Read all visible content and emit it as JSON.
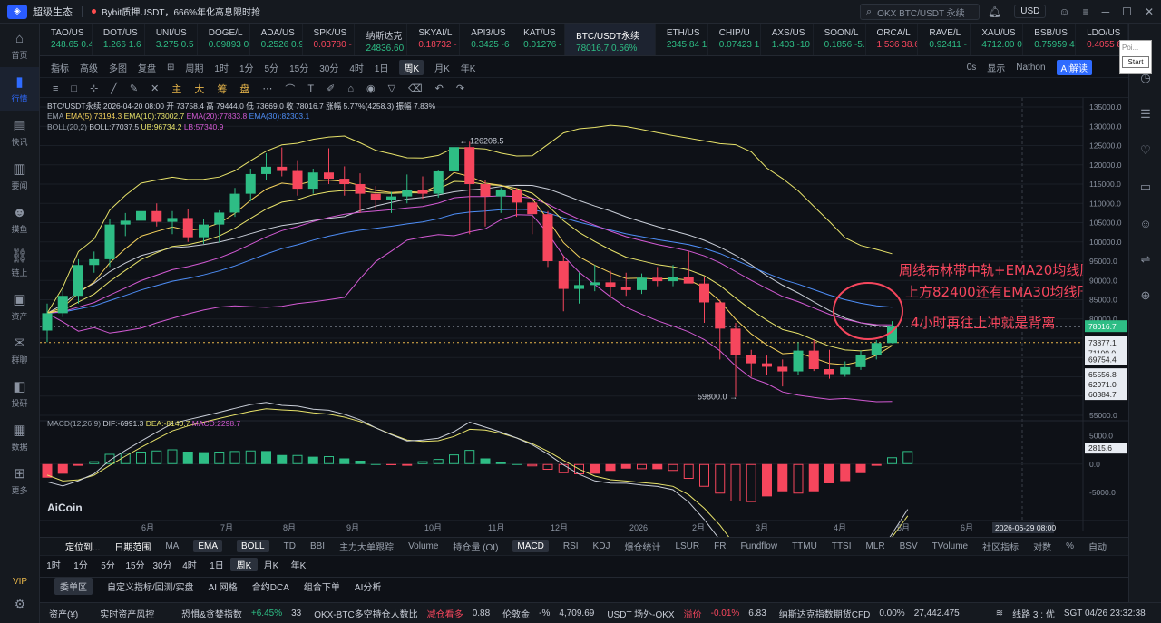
{
  "titlebar": {
    "app_name": "超级生态",
    "promo": "Bybit质押USDT，666%年化高息限时抢",
    "search_text": "OKX BTC/USDT 永续",
    "currency": "USD"
  },
  "sidebar": [
    {
      "label": "首页",
      "icon": "home-icon"
    },
    {
      "label": "行情",
      "icon": "chart-icon",
      "active": true
    },
    {
      "label": "快讯",
      "icon": "news-icon"
    },
    {
      "label": "要闻",
      "icon": "book-icon"
    },
    {
      "label": "摸鱼",
      "icon": "robot-icon"
    },
    {
      "label": "链上",
      "icon": "chain-icon"
    },
    {
      "label": "资产",
      "icon": "wallet-icon"
    },
    {
      "label": "群聊",
      "icon": "chat-icon"
    },
    {
      "label": "投研",
      "icon": "research-icon"
    },
    {
      "label": "数据",
      "icon": "data-icon"
    },
    {
      "label": "更多",
      "icon": "more-icon"
    }
  ],
  "sidebar_vip": "VIP",
  "tickers": [
    {
      "name": "TAO/US",
      "price": "248.65 0.4",
      "dir": "up"
    },
    {
      "name": "DOT/US",
      "price": "1.266 1.6",
      "dir": "up"
    },
    {
      "name": "UNI/US",
      "price": "3.275 0.5",
      "dir": "up"
    },
    {
      "name": "DOGE/L",
      "price": "0.09893 0",
      "dir": "up"
    },
    {
      "name": "ADA/US",
      "price": "0.2526 0.9",
      "dir": "up"
    },
    {
      "name": "SPK/US",
      "price": "0.03780 -",
      "dir": "dn"
    },
    {
      "name": "纳斯达克",
      "price": "24836.60 (",
      "dir": "up"
    },
    {
      "name": "SKYAI/L",
      "price": "0.18732 -",
      "dir": "dn"
    },
    {
      "name": "API3/US",
      "price": "0.3425 -6",
      "dir": "up"
    },
    {
      "name": "KAT/US",
      "price": "0.01276 -",
      "dir": "up"
    },
    {
      "name": "BTC/USDT永续",
      "price": "78016.7 0.56%",
      "dir": "up",
      "selected": true
    },
    {
      "name": "ETH/US",
      "price": "2345.84 1",
      "dir": "up"
    },
    {
      "name": "CHIP/U",
      "price": "0.07423 1",
      "dir": "up"
    },
    {
      "name": "AXS/US",
      "price": "1.403 -10",
      "dir": "up"
    },
    {
      "name": "SOON/L",
      "price": "0.1856 -5.",
      "dir": "up"
    },
    {
      "name": "ORCA/L",
      "price": "1.536 38.6",
      "dir": "dn"
    },
    {
      "name": "RAVE/L",
      "price": "0.92411 -",
      "dir": "up"
    },
    {
      "name": "XAU/US",
      "price": "4712.00 0",
      "dir": "up"
    },
    {
      "name": "BSB/US",
      "price": "0.75959 4",
      "dir": "up"
    },
    {
      "name": "LDO/US",
      "price": "0.4055 8.5",
      "dir": "dn"
    }
  ],
  "popup": {
    "poi": "Poi...",
    "start": "Start"
  },
  "toolbar1": {
    "items": [
      "指标",
      "高级",
      "多图",
      "复盘",
      "⊞",
      "周期",
      "1时",
      "1分",
      "5分",
      "15分",
      "30分",
      "4时",
      "1日",
      "周K",
      "月K",
      "年K"
    ],
    "active": "周K",
    "right": [
      "0s",
      "显示",
      "Nathon",
      "AI解读"
    ]
  },
  "toolbar2_cn": [
    "主",
    "大",
    "筹",
    "盘"
  ],
  "legend": {
    "line1": "BTC/USDT永续  2026-04-20 08:00  开 73758.4  高 79444.0  低 73669.0  收 78016.7  涨幅 5.77%(4258.3)  振幅 7.83%",
    "ema_label": "EMA",
    "ema5": "EMA(5):73194.3",
    "ema10": "EMA(10):73002.7",
    "ema20": "EMA(20):77833.8",
    "ema30": "EMA(30):82303.1",
    "boll_label": "BOLL(20,2)",
    "boll_mid": "BOLL:77037.5",
    "boll_ub": "UB:96734.2",
    "boll_lb": "LB:57340.9",
    "macd_label": "MACD(12,26,9)",
    "dif": "DIF:-6991.3",
    "dea": "DEA:-8140.7",
    "macd": "MACD:2298.7"
  },
  "annotation": {
    "line1": "周线布林带中轨+EMA20均线压制",
    "line2": "上方82400还有EMA30均线压制",
    "line3": "4小时再往上冲就是背离"
  },
  "chart_labels": {
    "high_label": "← 126208.5",
    "low_label": "59800.0 →",
    "watermark": "AiCoin",
    "date_tag": "2026-06-29 08:00"
  },
  "price_axis": {
    "ticks": [
      "135000.0",
      "130000.0",
      "125000.0",
      "120000.0",
      "115000.0",
      "110000.0",
      "105000.0",
      "100000.0",
      "95000.0",
      "90000.0",
      "85000.0",
      "80000.0",
      "75000.0",
      "70000.0",
      "65000.0",
      "60000.0",
      "55000.0"
    ],
    "current": "78016.7",
    "markers": [
      "73877.1",
      "71100.0",
      "69754.4",
      "65556.8",
      "62971.0",
      "60384.7"
    ],
    "macd_ticks": [
      "5000.0",
      "0.0",
      "-5000.0"
    ],
    "macd_current": "2815.6"
  },
  "time_axis": [
    "6月",
    "7月",
    "8月",
    "9月",
    "10月",
    "11月",
    "12月",
    "2026",
    "2月",
    "3月",
    "4月",
    "5月",
    "6月"
  ],
  "indicator_bar": {
    "items": [
      "定位到...",
      "日期范围",
      "MA",
      "EMA",
      "BOLL",
      "TD",
      "BBI",
      "主力大单跟踪",
      "Volume",
      "持仓量 (OI)",
      "MACD",
      "RSI",
      "KDJ",
      "爆仓统计",
      "LSUR",
      "FR",
      "Fundflow",
      "TTMU",
      "TTSI",
      "MLR",
      "BSV",
      "TVolume",
      "社区指标",
      "对数",
      "%",
      "自动"
    ],
    "active": [
      "EMA",
      "BOLL",
      "MACD"
    ]
  },
  "timeframes": {
    "items": [
      "1时",
      "1分",
      "5分",
      "15分",
      "30分",
      "4时",
      "1日",
      "周K",
      "月K",
      "年K"
    ],
    "active": "周K"
  },
  "bottom_tabs": {
    "items": [
      "委单区",
      "自定义指标/回测/实盘",
      "AI 网格",
      "合约DCA",
      "组合下单",
      "AI分析"
    ],
    "active": "委单区"
  },
  "statusbar": {
    "asset": "资产(¥)",
    "risk": "实时资产风控",
    "fear_label": "恐惧&贪婪指数",
    "fear_change": "+6.45%",
    "fear_value": "33",
    "ratio_label": "OKX-BTC多空持仓人数比",
    "ratio_tag": "减仓看多",
    "ratio_value": "0.88",
    "lun_label": "伦敦金",
    "lun_change": "-%",
    "lun_value": "4,709.69",
    "usdt_label": "USDT 场外-OKX",
    "usdt_tag": "溢价",
    "usdt_change": "-0.01%",
    "usdt_value": "6.83",
    "nas_label": "纳斯达克指数期货CFD",
    "nas_change": "0.00%",
    "nas_value": "27,442.475",
    "line": "线路 3 : 优",
    "time": "SGT 04/26 23:32:38"
  },
  "chart_data": {
    "type": "candlestick",
    "interval": "1W",
    "ylim": [
      55000,
      135000
    ],
    "candles": [
      {
        "o": 77000,
        "h": 84000,
        "l": 74000,
        "c": 81500
      },
      {
        "o": 81500,
        "h": 87500,
        "l": 80500,
        "c": 86000
      },
      {
        "o": 86000,
        "h": 95500,
        "l": 84000,
        "c": 94000
      },
      {
        "o": 94000,
        "h": 97500,
        "l": 92000,
        "c": 95500
      },
      {
        "o": 95500,
        "h": 106000,
        "l": 93500,
        "c": 104500
      },
      {
        "o": 104500,
        "h": 107500,
        "l": 101500,
        "c": 105500
      },
      {
        "o": 105500,
        "h": 109500,
        "l": 103500,
        "c": 108000
      },
      {
        "o": 108000,
        "h": 110000,
        "l": 104000,
        "c": 105200
      },
      {
        "o": 105200,
        "h": 108000,
        "l": 102000,
        "c": 106200
      },
      {
        "o": 106200,
        "h": 108500,
        "l": 100000,
        "c": 101200
      },
      {
        "o": 101200,
        "h": 106000,
        "l": 99500,
        "c": 104500
      },
      {
        "o": 104500,
        "h": 108200,
        "l": 99800,
        "c": 107600
      },
      {
        "o": 107600,
        "h": 114000,
        "l": 106500,
        "c": 112500
      },
      {
        "o": 112500,
        "h": 119000,
        "l": 110500,
        "c": 117600
      },
      {
        "o": 117600,
        "h": 123000,
        "l": 116000,
        "c": 119500
      },
      {
        "o": 119500,
        "h": 124500,
        "l": 117000,
        "c": 118400
      },
      {
        "o": 118400,
        "h": 121200,
        "l": 112000,
        "c": 113800
      },
      {
        "o": 113800,
        "h": 119000,
        "l": 112500,
        "c": 118000
      },
      {
        "o": 118000,
        "h": 124300,
        "l": 115000,
        "c": 116400
      },
      {
        "o": 116400,
        "h": 119600,
        "l": 112000,
        "c": 115000
      },
      {
        "o": 115000,
        "h": 117800,
        "l": 107500,
        "c": 112500
      },
      {
        "o": 112500,
        "h": 114500,
        "l": 108500,
        "c": 110800
      },
      {
        "o": 110800,
        "h": 113000,
        "l": 107500,
        "c": 111800
      },
      {
        "o": 111800,
        "h": 117500,
        "l": 110000,
        "c": 113500
      },
      {
        "o": 113500,
        "h": 117000,
        "l": 111200,
        "c": 112500
      },
      {
        "o": 112500,
        "h": 118500,
        "l": 111500,
        "c": 118300
      },
      {
        "o": 118300,
        "h": 126208.5,
        "l": 114000,
        "c": 124600
      },
      {
        "o": 124600,
        "h": 126000,
        "l": 102000,
        "c": 115000
      },
      {
        "o": 115000,
        "h": 116000,
        "l": 104000,
        "c": 111800
      },
      {
        "o": 111800,
        "h": 114000,
        "l": 107500,
        "c": 113600
      },
      {
        "o": 113600,
        "h": 114000,
        "l": 106500,
        "c": 110200
      },
      {
        "o": 110200,
        "h": 111000,
        "l": 102000,
        "c": 107200
      },
      {
        "o": 107200,
        "h": 108000,
        "l": 93500,
        "c": 95000
      },
      {
        "o": 95000,
        "h": 96500,
        "l": 82000,
        "c": 87800
      },
      {
        "o": 87800,
        "h": 92000,
        "l": 84000,
        "c": 88800
      },
      {
        "o": 88800,
        "h": 94000,
        "l": 87200,
        "c": 89500
      },
      {
        "o": 89500,
        "h": 92500,
        "l": 85500,
        "c": 88200
      },
      {
        "o": 88200,
        "h": 92000,
        "l": 86000,
        "c": 87500
      },
      {
        "o": 87500,
        "h": 91800,
        "l": 86500,
        "c": 90700
      },
      {
        "o": 90700,
        "h": 93500,
        "l": 88500,
        "c": 89800
      },
      {
        "o": 89800,
        "h": 94000,
        "l": 88500,
        "c": 90900
      },
      {
        "o": 90900,
        "h": 97500,
        "l": 90000,
        "c": 89200
      },
      {
        "o": 89200,
        "h": 91000,
        "l": 79000,
        "c": 84300
      },
      {
        "o": 84300,
        "h": 85000,
        "l": 69500,
        "c": 77500
      },
      {
        "o": 77500,
        "h": 79000,
        "l": 59800,
        "c": 70600
      },
      {
        "o": 70600,
        "h": 72000,
        "l": 65000,
        "c": 68500
      },
      {
        "o": 68500,
        "h": 70500,
        "l": 65500,
        "c": 67600
      },
      {
        "o": 67600,
        "h": 69500,
        "l": 62500,
        "c": 66400
      },
      {
        "o": 66400,
        "h": 74000,
        "l": 65500,
        "c": 71800
      },
      {
        "o": 71800,
        "h": 74500,
        "l": 66500,
        "c": 67000
      },
      {
        "o": 67000,
        "h": 72000,
        "l": 64500,
        "c": 65700
      },
      {
        "o": 65700,
        "h": 69000,
        "l": 65000,
        "c": 67500
      },
      {
        "o": 67500,
        "h": 71800,
        "l": 66800,
        "c": 70700
      },
      {
        "o": 70700,
        "h": 74500,
        "l": 69500,
        "c": 73758.4
      },
      {
        "o": 73758.4,
        "h": 79444.0,
        "l": 73669.0,
        "c": 78016.7
      }
    ],
    "series": [
      {
        "name": "EMA(5)",
        "color": "#f6d35d"
      },
      {
        "name": "EMA(10)",
        "color": "#e8e36a"
      },
      {
        "name": "EMA(20)",
        "color": "#d35ad4"
      },
      {
        "name": "EMA(30)",
        "color": "#4e8ef7"
      },
      {
        "name": "BOLL",
        "color": "#c9ced8"
      },
      {
        "name": "UB",
        "color": "#e8e36a"
      },
      {
        "name": "LB",
        "color": "#d35ad4"
      }
    ],
    "macd": {
      "ylim": [
        -9000,
        7000
      ],
      "hist": [
        -2400,
        -1700,
        -300,
        500,
        1800,
        2000,
        2200,
        2400,
        2600,
        2200,
        2100,
        2200,
        2300,
        2400,
        2300,
        1600,
        1600,
        1300,
        1400,
        1000,
        600,
        0,
        -200,
        -300,
        500,
        900,
        1700,
        2500,
        1000,
        400,
        0,
        -400,
        -1000,
        -1600,
        -1800,
        -1700,
        -1200,
        -800,
        -900,
        -900,
        -1200,
        -2600,
        -4000,
        -5200,
        -6600,
        -6700,
        -5700,
        -4800,
        -5200,
        -4800,
        -3400,
        -3000,
        -1600,
        -300,
        1200,
        2298.7
      ]
    }
  }
}
